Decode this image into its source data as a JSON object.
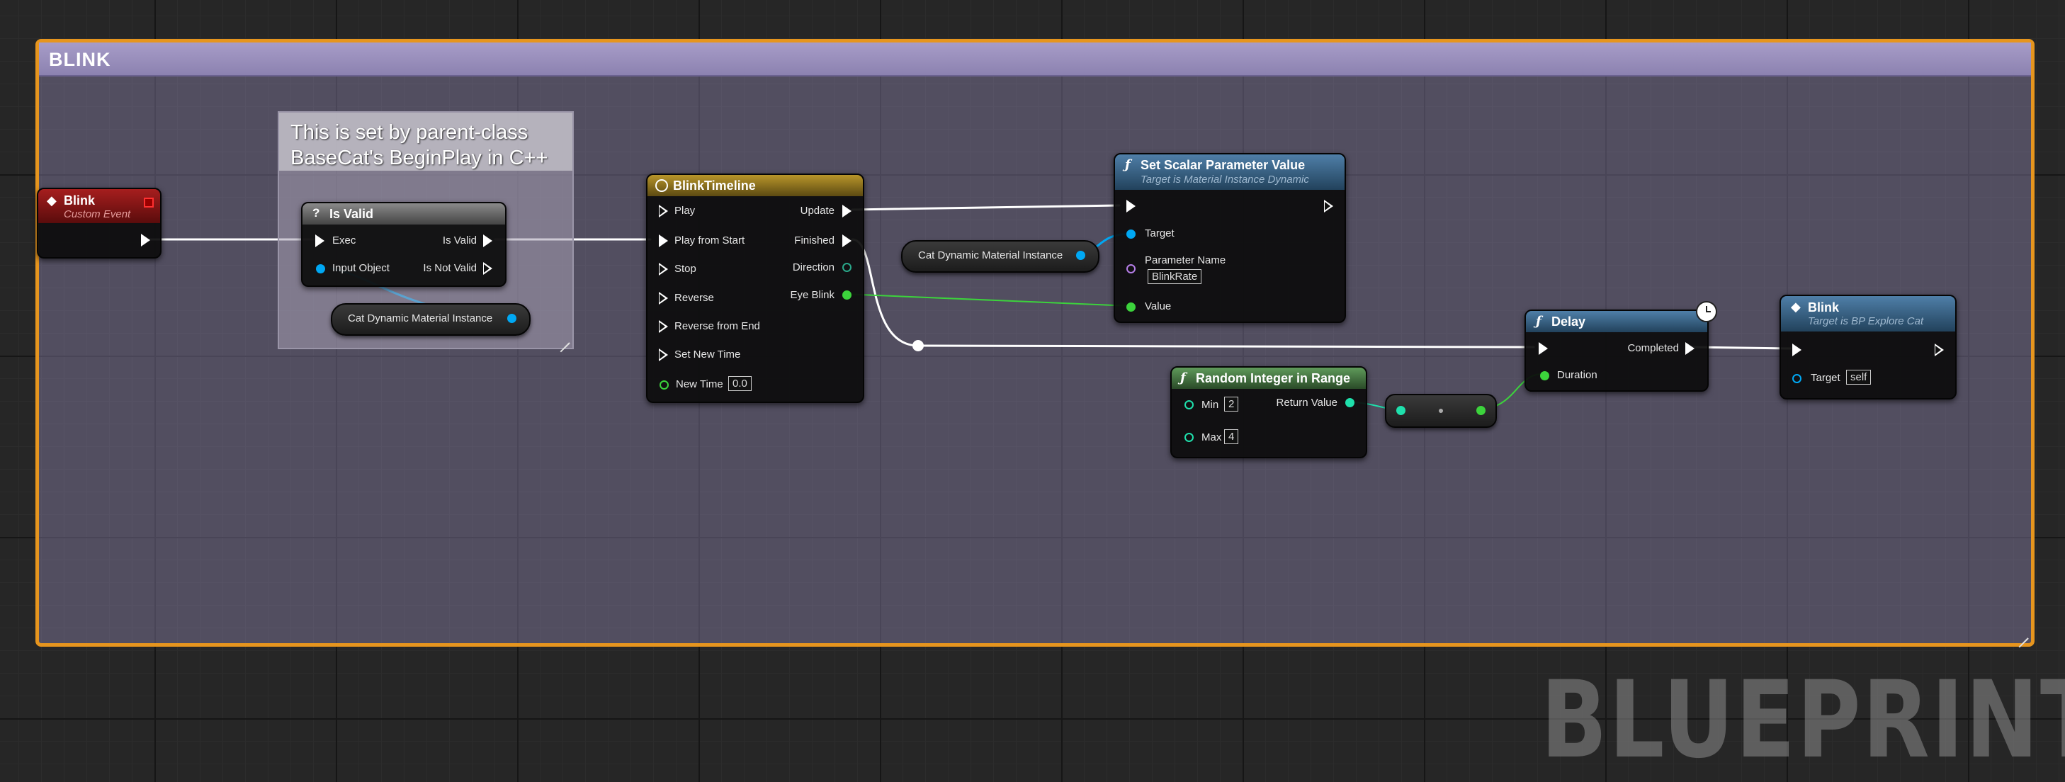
{
  "comment": {
    "title": "BLINK"
  },
  "sub_comment": {
    "text": "This is set by parent-class BaseCat's BeginPlay in C++"
  },
  "colors": {
    "comment_border": "#e6951e",
    "exec": "#ffffff",
    "object": "#00a8f4",
    "float": "#3cd33c",
    "int": "#1fe0ac",
    "name": "#b67ee8"
  },
  "event_node": {
    "title": "Blink",
    "subtitle": "Custom Event",
    "icon": "diamond-icon"
  },
  "isvalid_node": {
    "title": "Is Valid",
    "icon": "question-icon",
    "pins": {
      "exec": "Exec",
      "input": "Input Object",
      "is_valid": "Is Valid",
      "not_valid": "Is Not Valid"
    }
  },
  "cat_var_1": {
    "label": "Cat Dynamic Material Instance"
  },
  "timeline_node": {
    "title": "BlinkTimeline",
    "icon": "clock-icon",
    "inputs": [
      "Play",
      "Play from Start",
      "Stop",
      "Reverse",
      "Reverse from End",
      "Set New Time"
    ],
    "new_time_label": "New Time",
    "new_time_value": "0.0",
    "outputs": [
      "Update",
      "Finished",
      "Direction",
      "Eye Blink"
    ]
  },
  "cat_var_2": {
    "label": "Cat Dynamic Material Instance"
  },
  "setscalar_node": {
    "title": "Set Scalar Parameter Value",
    "subtitle": "Target is Material Instance Dynamic",
    "icon": "function-icon",
    "pins": {
      "target": "Target",
      "param_name": "Parameter Name",
      "param_value": "BlinkRate",
      "value": "Value"
    }
  },
  "random_node": {
    "title": "Random Integer in Range",
    "icon": "function-icon",
    "min_label": "Min",
    "min_value": "2",
    "max_label": "Max",
    "max_value": "4",
    "return_label": "Return Value"
  },
  "delay_node": {
    "title": "Delay",
    "icon": "function-icon",
    "completed": "Completed",
    "duration": "Duration",
    "latent_icon": "latent-clock-icon"
  },
  "blink_call_node": {
    "title": "Blink",
    "subtitle": "Target is BP Explore Cat",
    "icon": "diamond-icon",
    "target_label": "Target",
    "target_value": "self"
  },
  "watermark": "BLUEPRINT"
}
